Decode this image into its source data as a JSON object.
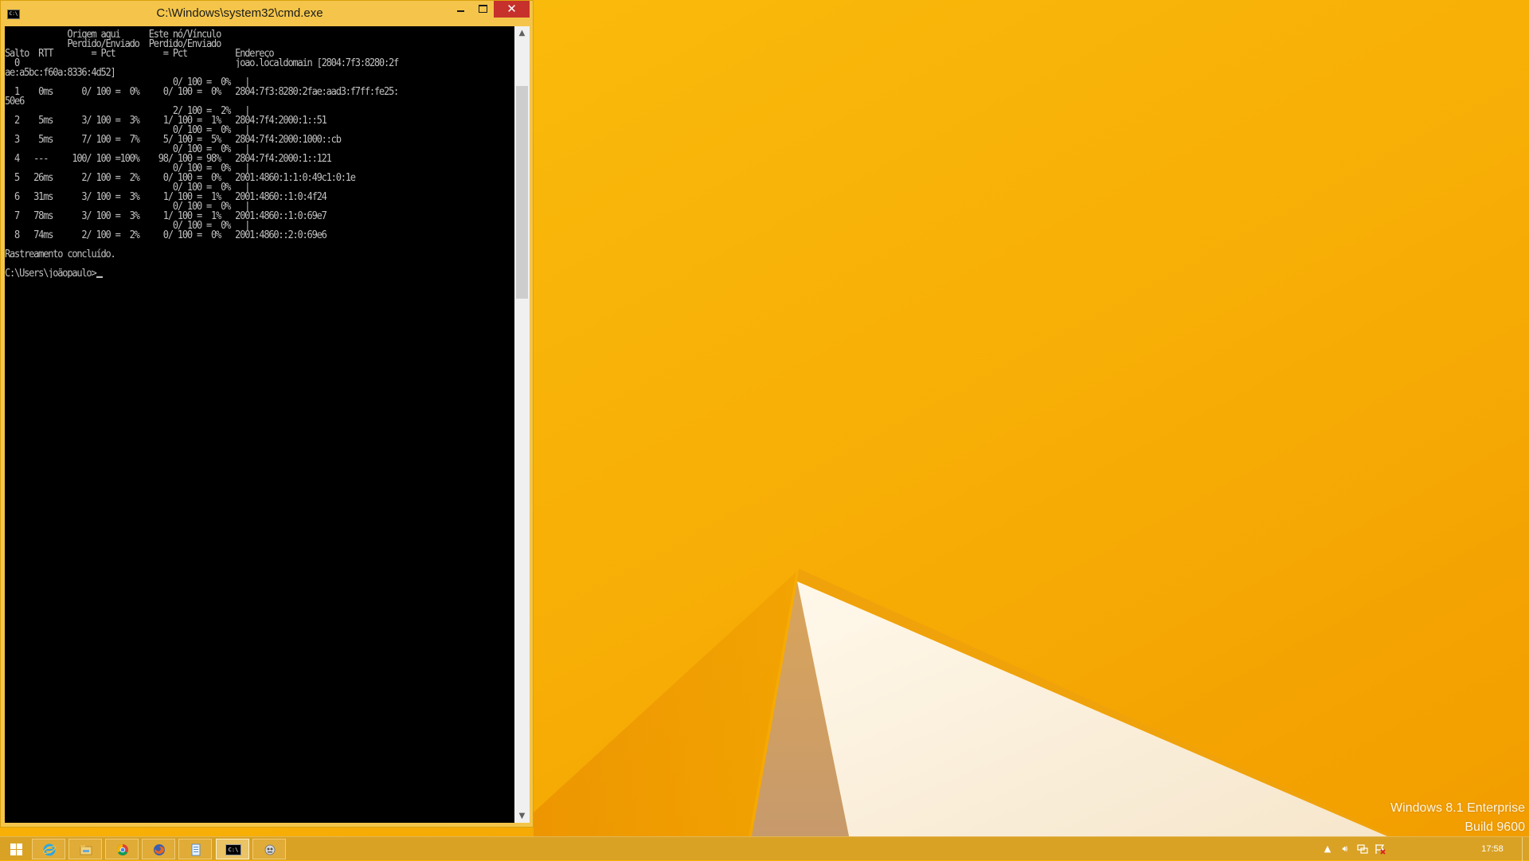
{
  "window": {
    "title": "C:\\Windows\\system32\\cmd.exe",
    "icon_label": "C:\\"
  },
  "console": {
    "lines": [
      "             Origem aqui      Este nó/Vínculo",
      "             Perdido/Enviado  Perdido/Enviado",
      "Salto  RTT        = Pct          = Pct          Endereço",
      "  0                                             joao.localdomain [2804:7f3:8280:2f",
      "ae:a5bc:f60a:8336:4d52]",
      "                                   0/ 100 =  0%   |",
      "  1    0ms      0/ 100 =  0%     0/ 100 =  0%   2804:7f3:8280:2fae:aad3:f7ff:fe25:",
      "50e6",
      "                                   2/ 100 =  2%   |",
      "  2    5ms      3/ 100 =  3%     1/ 100 =  1%   2804:7f4:2000:1::51",
      "                                   0/ 100 =  0%   |",
      "  3    5ms      7/ 100 =  7%     5/ 100 =  5%   2804:7f4:2000:1000::cb",
      "                                   0/ 100 =  0%   |",
      "  4   ---     100/ 100 =100%    98/ 100 = 98%   2804:7f4:2000:1::121",
      "                                   0/ 100 =  0%   |",
      "  5   26ms      2/ 100 =  2%     0/ 100 =  0%   2001:4860:1:1:0:49c1:0:1e",
      "                                   0/ 100 =  0%   |",
      "  6   31ms      3/ 100 =  3%     1/ 100 =  1%   2001:4860::1:0:4f24",
      "                                   0/ 100 =  0%   |",
      "  7   78ms      3/ 100 =  3%     1/ 100 =  1%   2001:4860::1:0:69e7",
      "                                   0/ 100 =  0%   |",
      "  8   74ms      2/ 100 =  2%     0/ 100 =  0%   2001:4860::2:0:69e6",
      "",
      "Rastreamento concluído.",
      "",
      "C:\\Users\\joãopaulo>"
    ]
  },
  "desktop": {
    "watermark_line1": "Windows 8.1 Enterprise",
    "watermark_line2": "Build 9600"
  },
  "taskbar": {
    "clock": "17:58",
    "pinned": [
      "start-icon",
      "ie-icon",
      "file-explorer-icon",
      "chrome-icon",
      "firefox-icon",
      "notepad-icon",
      "cmd-icon",
      "network-tool-icon"
    ],
    "cmd_icon_label": "C:\\",
    "tray": [
      "show-hidden-icons-icon",
      "volume-icon",
      "network-icon",
      "action-center-icon"
    ]
  },
  "colors": {
    "wallpaper": "#f7b500",
    "console_bg": "#000000",
    "console_fg": "#c0c0c0",
    "close_button": "#c7312b"
  }
}
